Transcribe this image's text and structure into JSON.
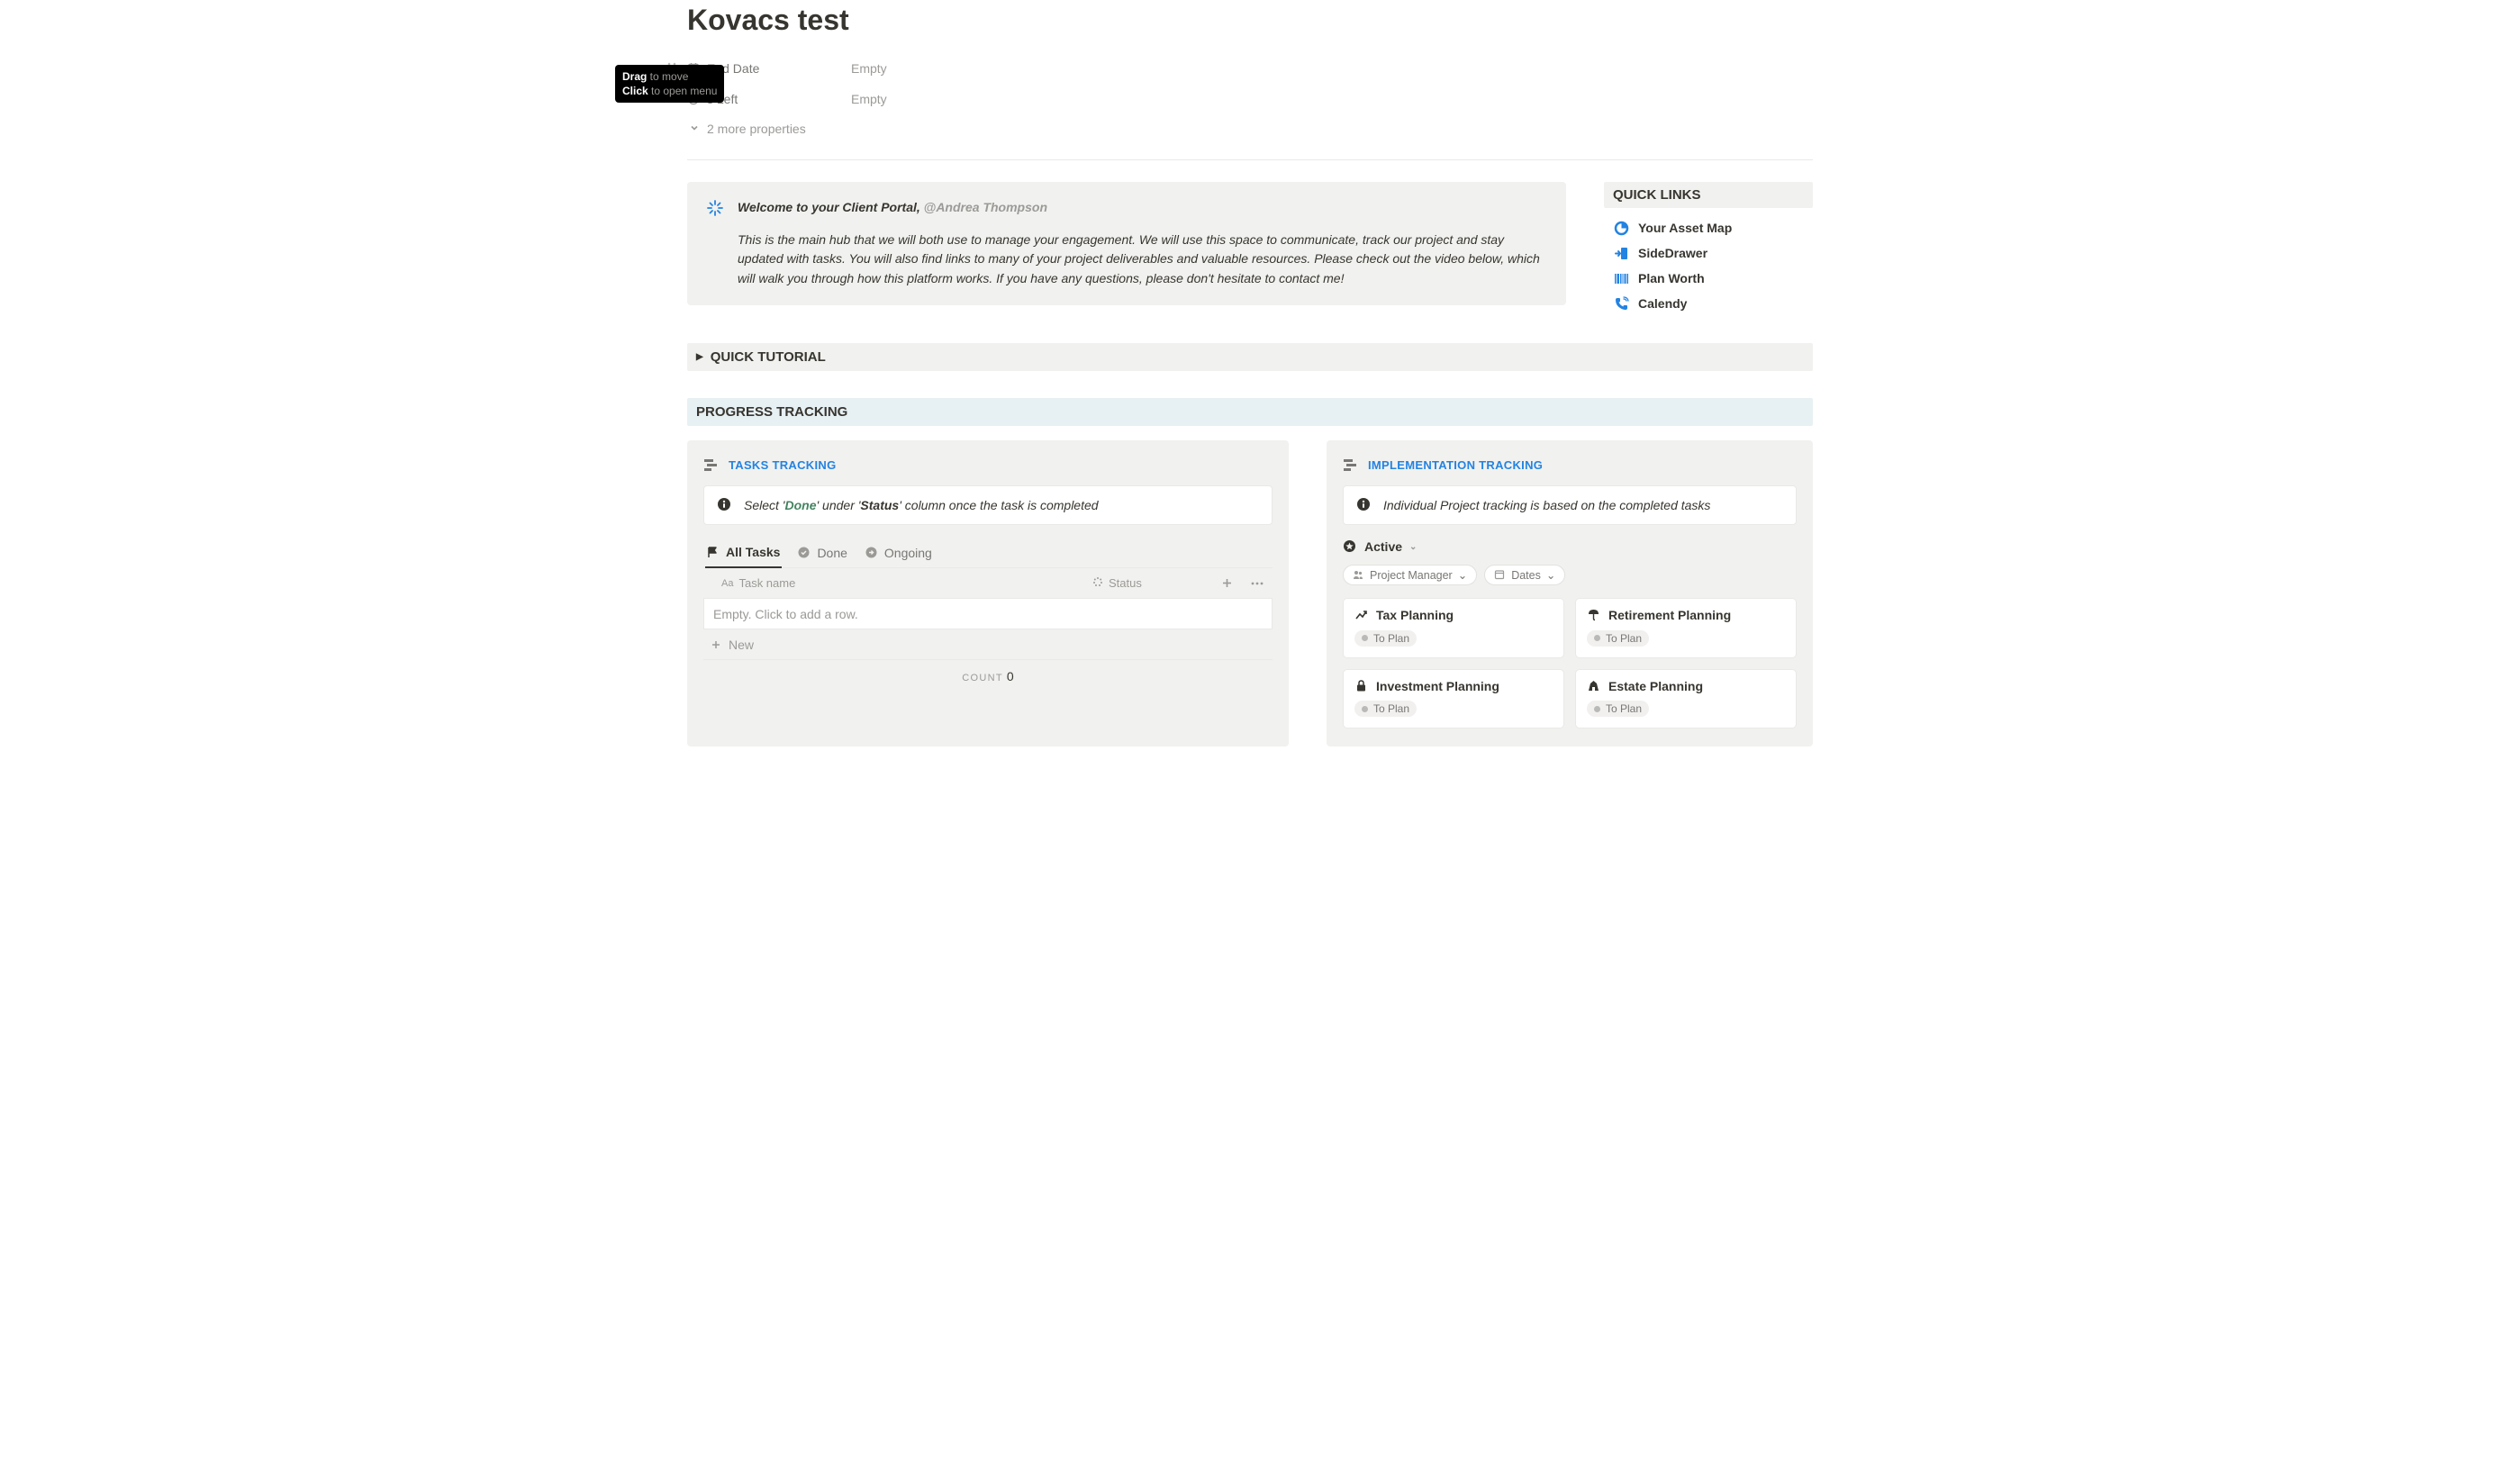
{
  "page_title": "Kovacs test",
  "tooltip": {
    "l1a": "Drag",
    "l1b": " to move",
    "l2a": "Click",
    "l2b": " to open menu"
  },
  "props": [
    {
      "icon": "calendar",
      "label": "End Date",
      "value": "Empty"
    },
    {
      "icon": "clock",
      "label": "s Left",
      "value": "Empty"
    }
  ],
  "more_props": "2 more properties",
  "callout": {
    "lead": "Welcome to your Client Portal, ",
    "mention": "@Andrea Thompson",
    "body": "This is the main hub that we will both use to manage your engagement. We will use this space to communicate, track our project and stay updated with tasks. You will also find links to many of your project deliverables and valuable resources. Please check out the video below, which will walk you through how this platform works. If you have any questions, please don't hesitate to contact me!"
  },
  "quicklinks": {
    "header": "QUICK LINKS",
    "items": [
      {
        "icon": "pie",
        "label": "Your Asset Map"
      },
      {
        "icon": "drawer",
        "label": "SideDrawer"
      },
      {
        "icon": "barcode",
        "label": "Plan Worth"
      },
      {
        "icon": "phone",
        "label": "Calendy"
      }
    ]
  },
  "tutorial_header": "QUICK TUTORIAL",
  "progress_header": "PROGRESS TRACKING",
  "tasks": {
    "title": "TASKS TRACKING",
    "info_pre": "Select '",
    "info_done": "Done",
    "info_mid": "' under '",
    "info_status": "Status",
    "info_post": "' column once the task is completed",
    "tabs": [
      {
        "icon": "flag",
        "label": "All Tasks",
        "active": true
      },
      {
        "icon": "check",
        "label": "Done",
        "active": false
      },
      {
        "icon": "arrow",
        "label": "Ongoing",
        "active": false
      }
    ],
    "columns": {
      "name": "Task name",
      "status": "Status"
    },
    "empty": "Empty. Click to add a row.",
    "new": "New",
    "count_label": "COUNT",
    "count_value": "0"
  },
  "impl": {
    "title": "IMPLEMENTATION TRACKING",
    "info": "Individual Project tracking is based on the completed tasks",
    "active_label": "Active",
    "filters": [
      {
        "icon": "people",
        "label": "Project Manager"
      },
      {
        "icon": "calendar",
        "label": "Dates"
      }
    ],
    "cards": [
      {
        "icon": "trend",
        "label": "Tax Planning",
        "status": "To Plan"
      },
      {
        "icon": "umbrella",
        "label": "Retirement Planning",
        "status": "To Plan"
      },
      {
        "icon": "lock",
        "label": "Investment Planning",
        "status": "To Plan"
      },
      {
        "icon": "estate",
        "label": "Estate Planning",
        "status": "To Plan"
      }
    ]
  }
}
